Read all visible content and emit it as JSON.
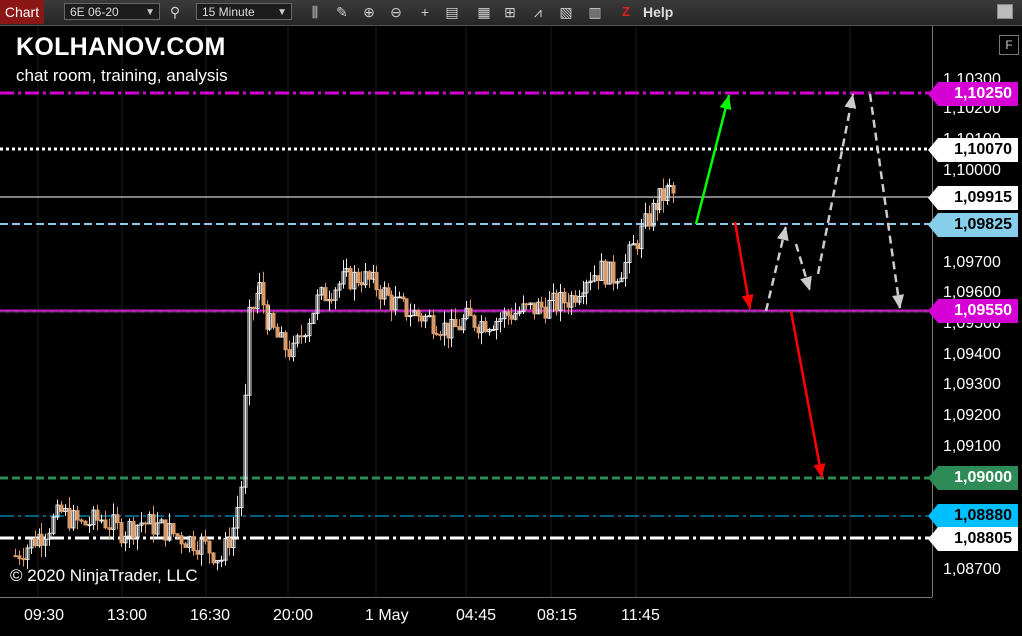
{
  "toolbar": {
    "tab": "Chart",
    "instrument": "6E 06-20",
    "interval": "15 Minute",
    "help": "Help",
    "z_icon": "Z",
    "icons": [
      "search-icon",
      "bar-style-icon",
      "draw-pencil-icon",
      "zoom-in-icon",
      "zoom-out-icon",
      "crosshair-icon",
      "data-box-icon",
      "indicators-icon",
      "strategies-icon",
      "drawing-tools-icon",
      "template-icon",
      "properties-icon"
    ]
  },
  "branding": {
    "title": "KOLHANOV.COM",
    "subtitle": "chat room, training, analysis",
    "copyright": "© 2020 NinjaTrader, LLC"
  },
  "price_axis": {
    "ticks": [
      "1,10300",
      "1,10200",
      "1,10100",
      "1,10000",
      "1,09700",
      "1,09600",
      "1,09500",
      "1,09400",
      "1,09300",
      "1,09200",
      "1,09100",
      "1,08700"
    ],
    "f_button": "F"
  },
  "time_axis": {
    "labels": [
      "09:30",
      "13:00",
      "16:30",
      "20:00",
      "1 May",
      "04:45",
      "08:15",
      "11:45"
    ]
  },
  "levels": [
    {
      "price": "1,10250",
      "color": "#d400d4",
      "text": "#ffffff",
      "style": "dashdot"
    },
    {
      "price": "1,10070",
      "color": "#ffffff",
      "text": "#000000",
      "style": "dotted"
    },
    {
      "price": "1,09915",
      "color": "#ffffff",
      "text": "#000000",
      "style": "thin"
    },
    {
      "price": "1,09825",
      "color": "#87ceeb",
      "text": "#000000",
      "style": "dashed"
    },
    {
      "price": "1,09550",
      "color": "#d400d4",
      "text": "#ffffff",
      "style": "solid"
    },
    {
      "price": "1,09000",
      "color": "#2e8b57",
      "text": "#ffffff",
      "style": "dashed"
    },
    {
      "price": "1,08880",
      "color": "#00bfff",
      "text": "#000000",
      "style": "dashdot"
    },
    {
      "price": "1,08805",
      "color": "#ffffff",
      "text": "#000000",
      "style": "dashdot"
    }
  ],
  "colors": {
    "up": "#e8e8e8",
    "down": "#d99a6a",
    "accent_green": "#00ff00",
    "accent_red": "#ff0000",
    "arrow_gray": "#cccccc"
  }
}
